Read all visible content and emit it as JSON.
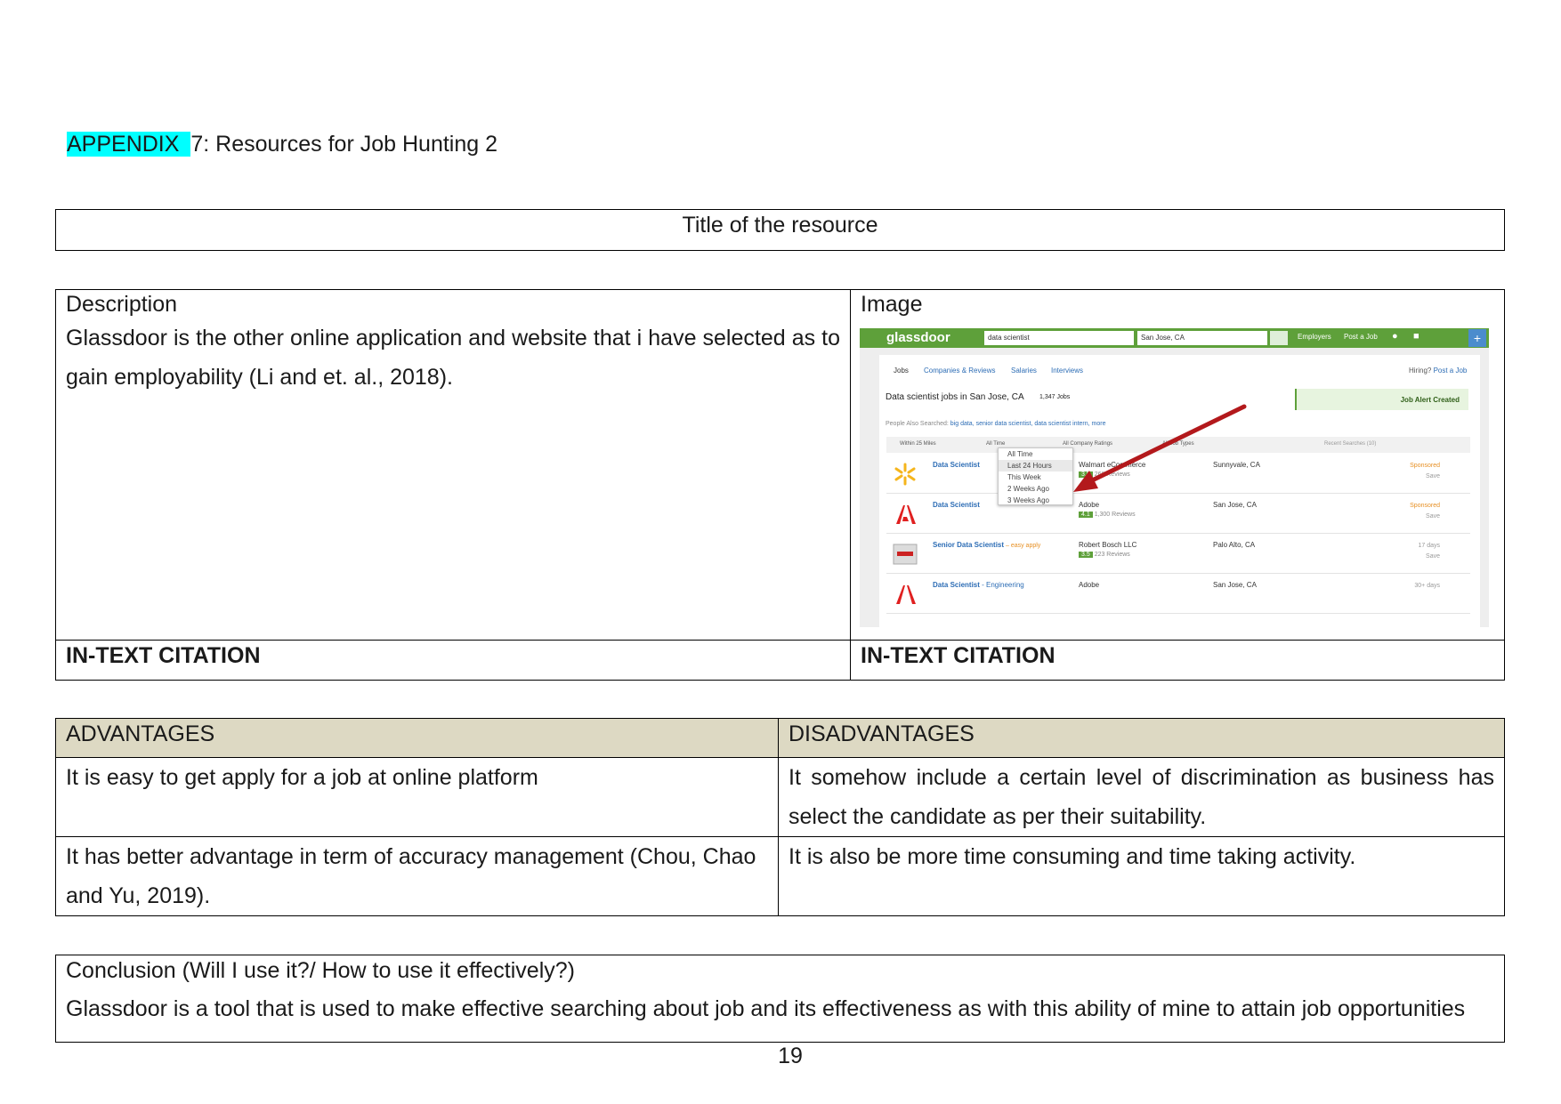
{
  "heading": {
    "highlight": "APPENDIX ",
    "rest": "7: Resources for Job Hunting 2"
  },
  "title_box": {
    "text": "Title of the resource"
  },
  "main_table": {
    "description_label": "Description",
    "description_text_before": "Glassdoor is the other online application and website that i have selected as to gain employability ",
    "description_text_cite": "(Li and et. al., 2018).",
    "image_label": "Image",
    "citation_left": "IN-TEXT CITATION",
    "citation_right": "IN-TEXT CITATION"
  },
  "screenshot": {
    "logo": "glassdoor",
    "search_query": "data scientist",
    "search_location": "San Jose, CA",
    "nav": [
      "Employers",
      "Post a Job"
    ],
    "tabs": [
      "Jobs",
      "Companies & Reviews",
      "Salaries",
      "Interviews"
    ],
    "hiring_text": "Hiring?",
    "hiring_link": "Post a Job",
    "results_title": "Data scientist jobs in San Jose, CA",
    "results_count": "1,347 Jobs",
    "alert": "Job Alert Created",
    "people_also_label": "People Also Searched:",
    "people_also_links": "big data, senior data scientist, data scientist intern, more",
    "filters": [
      "Within 25 Miles",
      "All Time",
      "All Company Ratings",
      "All Job Types"
    ],
    "recent_searches": "Recent Searches (10)",
    "dropdown_options": [
      "All Time",
      "Last 24 Hours",
      "This Week",
      "2 Weeks Ago",
      "3 Weeks Ago"
    ],
    "jobs": [
      {
        "title": "Data Scientist",
        "tag": "",
        "company": "Walmart eCommerce",
        "rating": "3.5",
        "reviews": "268 Reviews",
        "location": "Sunnyvale, CA",
        "side": "Sponsored",
        "save": "Save"
      },
      {
        "title": "Data Scientist",
        "tag": "",
        "company": "Adobe",
        "rating": "4.1",
        "reviews": "1,300 Reviews",
        "location": "San Jose, CA",
        "side": "Sponsored",
        "save": "Save"
      },
      {
        "title": "Senior Data Scientist",
        "tag": " – easy apply",
        "company": "Robert Bosch LLC",
        "rating": "3.5",
        "reviews": "223 Reviews",
        "location": "Palo Alto, CA",
        "side": "17 days",
        "save": "Save"
      },
      {
        "title": "Data Scientist",
        "tag": " - Engineering",
        "company": "Adobe",
        "rating": "",
        "reviews": "",
        "location": "San Jose, CA",
        "side": "30+ days",
        "save": ""
      }
    ],
    "colors": {
      "brand_green": "#5ea03a",
      "arrow_red": "#b3191c"
    }
  },
  "adv_table": {
    "adv_header": "ADVANTAGES",
    "dis_header": "DISADVANTAGES",
    "rows": [
      {
        "adv": "It is easy to get apply for a job at online platform",
        "dis": "It somehow include a certain level of discrimination as business has select the candidate as per their suitability."
      },
      {
        "adv": "It has better advantage in term of accuracy management (Chou, Chao and Yu, 2019).",
        "dis": "It is also be more time consuming and time taking activity."
      }
    ],
    "header_bg": "#ddd9c3"
  },
  "conclusion": {
    "label": "Conclusion (Will I use it?/ How to use it effectively?)",
    "text": "Glassdoor is a tool that is used to make effective searching about job and its effectiveness as with this ability of mine to attain job opportunities"
  },
  "page_number": "19"
}
